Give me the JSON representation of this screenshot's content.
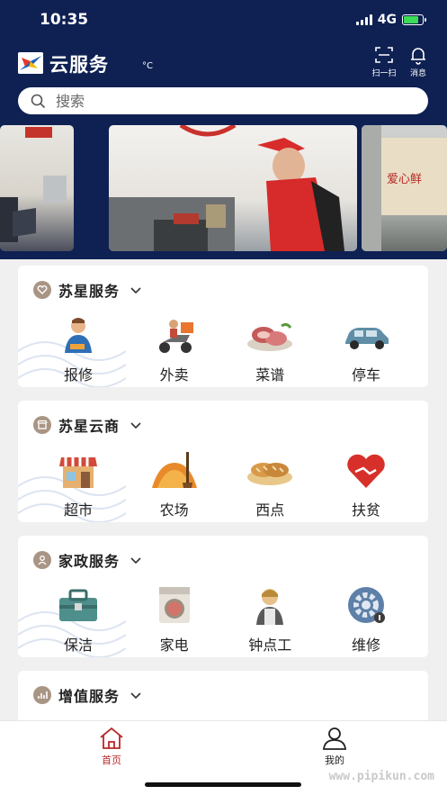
{
  "status": {
    "time": "10:35",
    "network": "4G"
  },
  "header": {
    "title": "云服务",
    "temperature_unit": "°C",
    "scan_label": "扫一扫",
    "message_label": "消息"
  },
  "search": {
    "placeholder": "搜索"
  },
  "sections": [
    {
      "title": "苏星服务",
      "items": [
        {
          "label": "报修",
          "icon": "repair-worker-icon"
        },
        {
          "label": "外卖",
          "icon": "delivery-scooter-icon"
        },
        {
          "label": "菜谱",
          "icon": "meat-dish-icon"
        },
        {
          "label": "停车",
          "icon": "car-icon"
        }
      ]
    },
    {
      "title": "苏星云商",
      "items": [
        {
          "label": "超市",
          "icon": "supermarket-icon"
        },
        {
          "label": "农场",
          "icon": "farm-icon"
        },
        {
          "label": "西点",
          "icon": "bread-icon"
        },
        {
          "label": "扶贫",
          "icon": "heart-handshake-icon"
        }
      ]
    },
    {
      "title": "家政服务",
      "items": [
        {
          "label": "保洁",
          "icon": "toolbox-icon"
        },
        {
          "label": "家电",
          "icon": "washing-machine-icon"
        },
        {
          "label": "钟点工",
          "icon": "housekeeper-icon"
        },
        {
          "label": "维修",
          "icon": "gear-icon"
        }
      ]
    },
    {
      "title": "增值服务",
      "items": []
    }
  ],
  "tabbar": {
    "home_label": "首页",
    "mine_label": "我的"
  },
  "colors": {
    "navy": "#0f2153",
    "accent": "#b8272a",
    "section_icon": "#a99584"
  },
  "watermark": "www.pipikun.com"
}
